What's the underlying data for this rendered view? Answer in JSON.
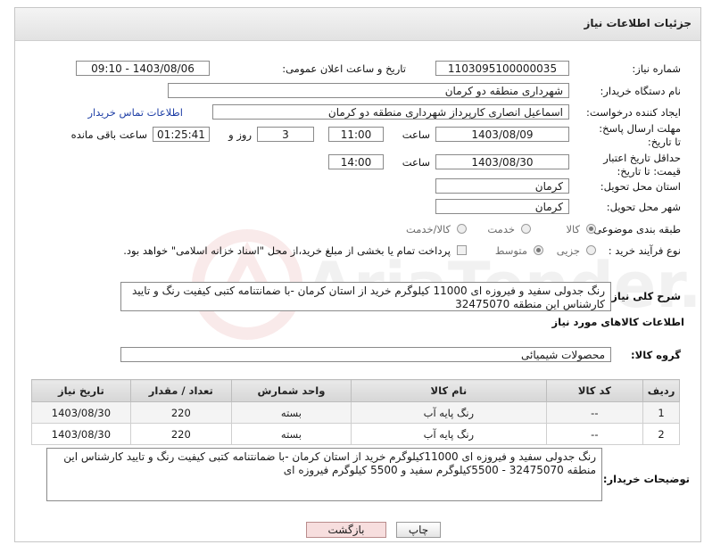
{
  "header": {
    "title": "جزئیات اطلاعات نیاز"
  },
  "fields": {
    "need_number_label": "شماره نیاز:",
    "need_number": "1103095100000035",
    "announce_label": "تاریخ و ساعت اعلان عمومی:",
    "announce_value": "1403/08/06 - 09:10",
    "buyer_label": "نام دستگاه خریدار:",
    "buyer_value": "شهرداری منطقه دو کرمان",
    "creator_label": "ایجاد کننده درخواست:",
    "creator_value": "اسماعیل انصاری کارپرداز شهرداری منطقه دو کرمان",
    "contact_link": "اطلاعات تماس خریدار",
    "deadline_label": "مهلت ارسال پاسخ: تا تاریخ:",
    "deadline_date": "1403/08/09",
    "time_label": "ساعت",
    "deadline_time": "11:00",
    "days_value": "3",
    "days_label": "روز و",
    "remaining_value": "01:25:41",
    "remaining_label": "ساعت باقی مانده",
    "validity_label": "حداقل تاریخ اعتبار قیمت: تا تاریخ:",
    "validity_date": "1403/08/30",
    "validity_time_label": "ساعت",
    "validity_time": "14:00",
    "province_label": "استان محل تحویل:",
    "province_value": "کرمان",
    "city_label": "شهر محل تحویل:",
    "city_value": "کرمان",
    "category_label": "طبقه بندی موضوعی:",
    "category_options": [
      "کالا",
      "خدمت",
      "کالا/خدمت"
    ],
    "process_label": "نوع فرآیند خرید :",
    "process_options": [
      "جزیی",
      "متوسط"
    ],
    "payment_note": "پرداخت تمام یا بخشی از مبلغ خرید،از محل \"اسناد خزانه اسلامی\" خواهد بود.",
    "summary_label": "شرح کلی نیاز:",
    "summary_value": "رنگ جدولی سفید و فیروزه ای 11000 کیلوگرم  خرید از استان کرمان -با ضمانتنامه کتبی کیفیت رنگ و تایید کارشناس این منطقه 32475070",
    "goods_info_title": "اطلاعات کالاهای مورد نیاز",
    "goods_group_label": "گروه کالا:",
    "goods_group_value": "محصولات شیمیائی",
    "buyer_notes_label": "توضیحات خریدار:",
    "buyer_notes_value": "رنگ جدولی سفید و فیروزه ای 11000کیلوگرم  خرید از استان کرمان -با ضمانتنامه کتبی کیفیت رنگ و تایید کارشناس این منطقه 32475070  - 5500کیلوگرم سفید و 5500 کیلوگرم فیروزه ای"
  },
  "table": {
    "columns": [
      "ردیف",
      "کد کالا",
      "نام کالا",
      "واحد شمارش",
      "تعداد / مقدار",
      "تاریخ نیاز"
    ],
    "rows": [
      [
        "1",
        "--",
        "رنگ پایه آب",
        "بسته",
        "220",
        "1403/08/30"
      ],
      [
        "2",
        "--",
        "رنگ پایه آب",
        "بسته",
        "220",
        "1403/08/30"
      ]
    ]
  },
  "buttons": {
    "print": "چاپ",
    "back": "بازگشت"
  },
  "watermark": {
    "text": "AriaTender.neT"
  },
  "colors": {
    "link": "#1f3fa6",
    "back_button_bg": "#f7dede"
  }
}
